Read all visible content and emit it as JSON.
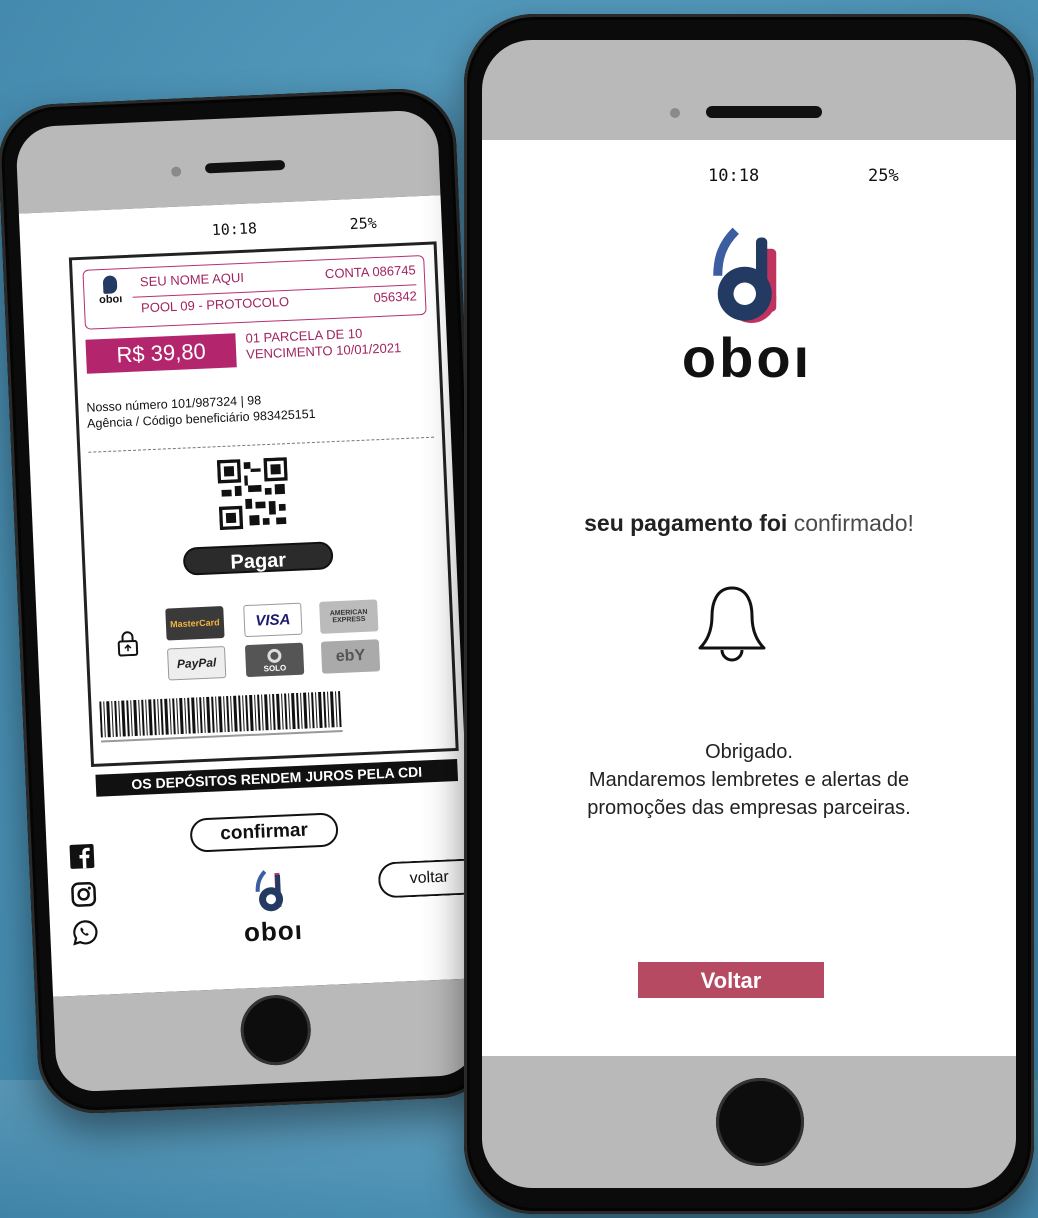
{
  "status": {
    "time": "10:18",
    "battery": "25%"
  },
  "boleto": {
    "name": "SEU NOME AQUI",
    "account": "CONTA 086745",
    "pool": "POOL 09 - PROTOCOLO",
    "protocol": "056342",
    "amount": "R$ 39,80",
    "installment": "01 PARCELA DE 10",
    "due": "VENCIMENTO 10/01/2021",
    "nosso_numero": "Nosso número 101/987324 | 98",
    "agencia": "Agência / Código beneficiário 983425151",
    "pay_button": "Pagar",
    "cards": [
      "MasterCard",
      "VISA",
      "AMERICAN EXPRESS",
      "PayPal",
      "SOLO",
      "ebY"
    ]
  },
  "banner": "OS DEPÓSITOS RENDEM JUROS PELA CDI",
  "buttons": {
    "confirm": "confirmar",
    "back_small": "voltar",
    "back_big": "Voltar"
  },
  "brand": {
    "name": "oboı",
    "color_primary": "#233a63",
    "color_accent": "#c0335e"
  },
  "confirmation": {
    "part1": "seu pagamento foi",
    "part2": "confirmado!",
    "thanks_line1": "Obrigado.",
    "thanks_line2": "Mandaremos lembretes e alertas de",
    "thanks_line3": "promoções das empresas parceiras."
  },
  "social": [
    "facebook-icon",
    "instagram-icon",
    "whatsapp-icon"
  ]
}
